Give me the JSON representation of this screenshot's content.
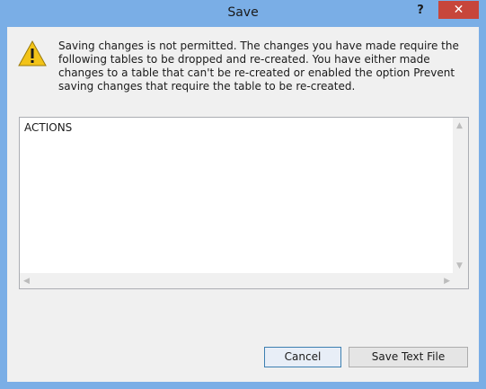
{
  "window": {
    "title": "Save"
  },
  "titlebar": {
    "help_glyph": "?",
    "close_glyph": "✕",
    "close_color": "#c7463b"
  },
  "dialog": {
    "message": "Saving changes is not permitted. The changes you have made require the following tables to be dropped and re-created. You have either made changes to a table that can't be re-created or enabled the option Prevent saving changes that require the table to be re-created.",
    "icon": "warning-icon"
  },
  "actions_list": {
    "text": "ACTIONS"
  },
  "buttons": {
    "cancel": "Cancel",
    "save_text_file": "Save Text File"
  },
  "colors": {
    "frame": "#7aaee6",
    "client_bg": "#f0f0f0",
    "warning_yellow": "#f2c318"
  }
}
